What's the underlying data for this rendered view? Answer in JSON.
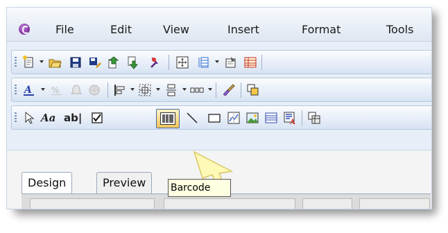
{
  "menubar": {
    "items": [
      "File",
      "Edit",
      "View",
      "Insert",
      "Format",
      "Tools"
    ]
  },
  "tabs": [
    "Design",
    "Preview"
  ],
  "tooltip": {
    "text": "Barcode"
  },
  "toolbar3": {
    "text_tool_label": "Aa",
    "textfield_label": "ab|"
  },
  "icons": {
    "app": "app-logo-icon",
    "barcode": "barcode-icon"
  },
  "colors": {
    "toolbar_bg": "#e7eef7",
    "tooltip_bg": "#ffffe1",
    "selected_button": "#f4c55a"
  }
}
